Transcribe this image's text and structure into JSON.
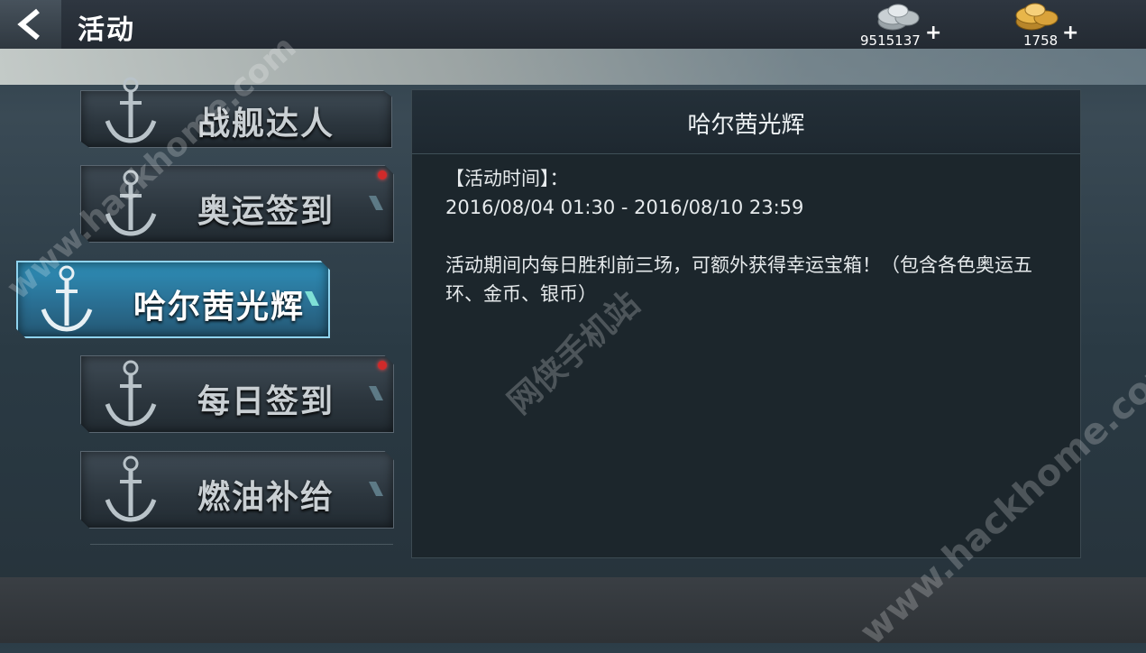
{
  "header": {
    "title": "活动",
    "silver": {
      "value": "9515137",
      "plus": "+"
    },
    "gold": {
      "value": "1758",
      "plus": "+"
    }
  },
  "menu": {
    "items": [
      {
        "label": "战舰达人",
        "active": false,
        "badge": false
      },
      {
        "label": "奥运签到",
        "active": false,
        "badge": true
      },
      {
        "label": "哈尔茜光辉",
        "active": true,
        "badge": false
      },
      {
        "label": "每日签到",
        "active": false,
        "badge": true
      },
      {
        "label": "燃油补给",
        "active": false,
        "badge": false
      }
    ]
  },
  "detail": {
    "title": "哈尔茜光辉",
    "time_heading": "【活动时间】：",
    "time_range": "2016/08/04 01:30 - 2016/08/10 23:59",
    "description": "活动期间内每日胜利前三场，可额外获得幸运宝箱！（包含各色奥运五环、金币、银币）"
  },
  "watermarks": {
    "left": "www.hackhome.com",
    "center": "网侠手机站",
    "right": "www.hackhome.com"
  },
  "colors": {
    "active_tab": "#2e8fb8",
    "badge": "#d12a2a",
    "panel_bg": "#1c262c"
  }
}
